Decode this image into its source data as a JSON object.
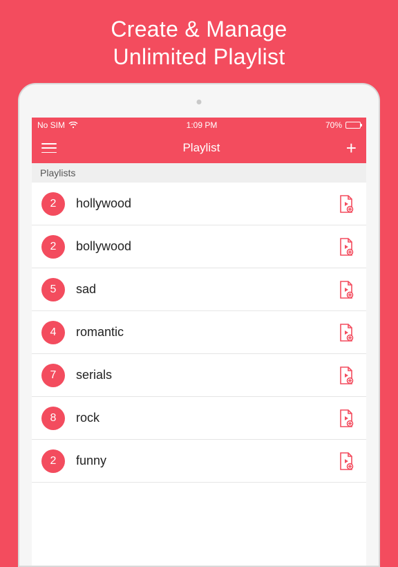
{
  "promo": {
    "line1": "Create & Manage",
    "line2": "Unlimited Playlist"
  },
  "status": {
    "carrier": "No SIM",
    "time": "1:09 PM",
    "battery_pct": "70%"
  },
  "nav": {
    "title": "Playlist"
  },
  "section_header": "Playlists",
  "playlists": [
    {
      "count": "2",
      "name": "hollywood"
    },
    {
      "count": "2",
      "name": "bollywood"
    },
    {
      "count": "5",
      "name": "sad"
    },
    {
      "count": "4",
      "name": "romantic"
    },
    {
      "count": "7",
      "name": "serials"
    },
    {
      "count": "8",
      "name": "rock"
    },
    {
      "count": "2",
      "name": "funny"
    }
  ],
  "colors": {
    "accent": "#f34c5e"
  }
}
